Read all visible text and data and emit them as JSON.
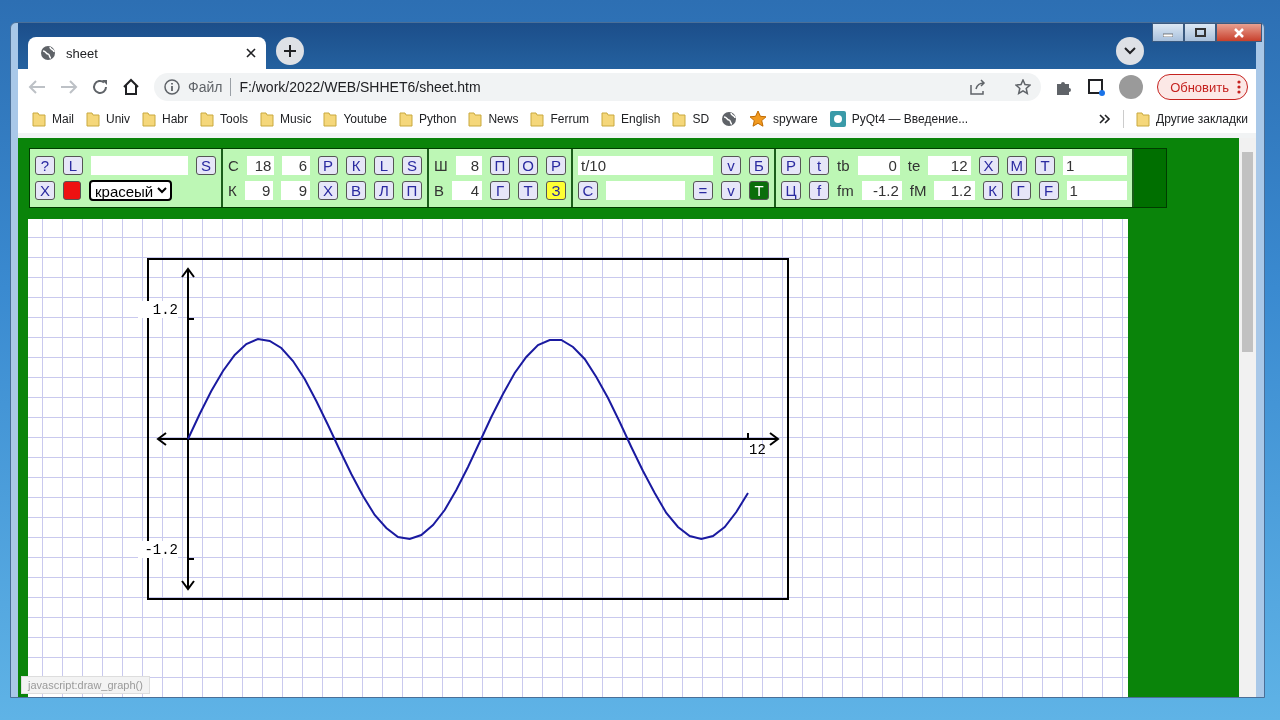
{
  "browser": {
    "tab": {
      "title": "sheet"
    },
    "address": {
      "scheme_label": "Файл",
      "url": "F:/work/2022/WEB/SHHET6/sheet.htm"
    },
    "update_button": "Обновить",
    "bookmarks": [
      {
        "kind": "folder",
        "label": "Mail"
      },
      {
        "kind": "folder",
        "label": "Univ"
      },
      {
        "kind": "folder",
        "label": "Habr"
      },
      {
        "kind": "folder",
        "label": "Tools"
      },
      {
        "kind": "folder",
        "label": "Music"
      },
      {
        "kind": "folder",
        "label": "Youtube"
      },
      {
        "kind": "folder",
        "label": "Python"
      },
      {
        "kind": "folder",
        "label": "News"
      },
      {
        "kind": "folder",
        "label": "Ferrum"
      },
      {
        "kind": "folder",
        "label": "English"
      },
      {
        "kind": "folder",
        "label": "SD"
      },
      {
        "kind": "globe"
      },
      {
        "kind": "star",
        "label": "spyware"
      },
      {
        "kind": "app",
        "label": "PyQt4 — Введение..."
      }
    ],
    "other_bookmarks": "Другие закладки",
    "status_text": "javascript:draw_graph()"
  },
  "panel": {
    "sections": [
      {
        "lines": [
          {
            "items": [
              {
                "kind": "button",
                "label": "?"
              },
              {
                "kind": "button",
                "label": "L"
              },
              {
                "kind": "text-field"
              },
              {
                "kind": "button",
                "label": "S"
              }
            ]
          },
          {
            "items": [
              {
                "kind": "button",
                "label": "X"
              },
              {
                "kind": "swatch",
                "color": "#ee1111"
              },
              {
                "kind": "select",
                "value": "красеый"
              }
            ]
          }
        ]
      },
      {
        "lines": [
          {
            "items": [
              {
                "kind": "label",
                "label": "С"
              },
              {
                "kind": "number-field",
                "value": "18"
              },
              {
                "kind": "number-field",
                "value": "6"
              },
              {
                "kind": "button",
                "label": "Р"
              },
              {
                "kind": "button",
                "label": "К"
              },
              {
                "kind": "button",
                "label": "L"
              },
              {
                "kind": "button",
                "label": "S"
              }
            ]
          },
          {
            "items": [
              {
                "kind": "label",
                "label": "К"
              },
              {
                "kind": "number-field",
                "value": "9"
              },
              {
                "kind": "number-field",
                "value": "9"
              },
              {
                "kind": "button",
                "label": "Х"
              },
              {
                "kind": "button",
                "label": "В"
              },
              {
                "kind": "button",
                "label": "Л"
              },
              {
                "kind": "button",
                "label": "П"
              }
            ]
          }
        ]
      },
      {
        "lines": [
          {
            "items": [
              {
                "kind": "label",
                "label": "Ш"
              },
              {
                "kind": "number-field",
                "value": "8"
              },
              {
                "kind": "button",
                "label": "П"
              },
              {
                "kind": "button",
                "label": "О"
              },
              {
                "kind": "button",
                "label": "Р"
              }
            ]
          },
          {
            "items": [
              {
                "kind": "label",
                "label": "В"
              },
              {
                "kind": "number-field",
                "value": "4"
              },
              {
                "kind": "button",
                "label": "Г"
              },
              {
                "kind": "button",
                "label": "Т"
              },
              {
                "kind": "button",
                "label": "З",
                "color": "#ffff33"
              }
            ]
          }
        ]
      },
      {
        "lines": [
          {
            "items": [
              {
                "kind": "text-field",
                "value": "t/10"
              },
              {
                "kind": "button",
                "label": "v"
              },
              {
                "kind": "button",
                "label": "Б"
              }
            ]
          },
          {
            "items": [
              {
                "kind": "button",
                "label": "С"
              },
              {
                "kind": "text-field"
              },
              {
                "kind": "button",
                "label": "="
              },
              {
                "kind": "button",
                "label": "v"
              },
              {
                "kind": "button",
                "label": "Т",
                "color": "#0b6e0b"
              }
            ]
          }
        ]
      },
      {
        "lines": [
          {
            "items": [
              {
                "kind": "button",
                "label": "Р"
              },
              {
                "kind": "button",
                "label": "t"
              },
              {
                "kind": "label",
                "label": "tb"
              },
              {
                "kind": "number-field",
                "value": "0"
              },
              {
                "kind": "label",
                "label": "te"
              },
              {
                "kind": "number-field",
                "value": "12"
              },
              {
                "kind": "button",
                "label": "Х"
              },
              {
                "kind": "button",
                "label": "М"
              },
              {
                "kind": "button",
                "label": "Т"
              },
              {
                "kind": "text-field",
                "value": "1"
              }
            ]
          },
          {
            "items": [
              {
                "kind": "button",
                "label": "Ц"
              },
              {
                "kind": "button",
                "label": "f"
              },
              {
                "kind": "label",
                "label": "fm"
              },
              {
                "kind": "number-field",
                "value": "-1.2"
              },
              {
                "kind": "label",
                "label": "fM"
              },
              {
                "kind": "number-field",
                "value": "1.2"
              },
              {
                "kind": "button",
                "label": "К"
              },
              {
                "kind": "button",
                "label": "Г"
              },
              {
                "kind": "button",
                "label": "F"
              },
              {
                "kind": "text-field",
                "value": "1"
              }
            ]
          }
        ]
      }
    ]
  },
  "graph": {
    "chart_data": {
      "type": "line",
      "ylim": [
        -1.6,
        1.8
      ],
      "yticks": [
        {
          "value": 1.2,
          "label": "1.2"
        },
        {
          "value": -1.2,
          "label": "-1.2"
        }
      ],
      "annotations": [
        {
          "text": "12"
        }
      ],
      "series": [
        {
          "color": "#1a1aa0",
          "values": [
            0,
            0.25,
            0.48,
            0.68,
            0.84,
            0.95,
            1.0,
            0.98,
            0.91,
            0.78,
            0.6,
            0.38,
            0.14,
            -0.11,
            -0.35,
            -0.57,
            -0.76,
            -0.89,
            -0.98,
            -1.0,
            -0.96,
            -0.86,
            -0.71,
            -0.51,
            -0.28,
            -0.03,
            0.22,
            0.45,
            0.66,
            0.82,
            0.94,
            0.99,
            0.99,
            0.92,
            0.8,
            0.62,
            0.41,
            0.17,
            -0.08,
            -0.32,
            -0.54,
            -0.74,
            -0.88,
            -0.97,
            -1.0,
            -0.97,
            -0.88,
            -0.73,
            -0.54
          ]
        }
      ]
    }
  }
}
